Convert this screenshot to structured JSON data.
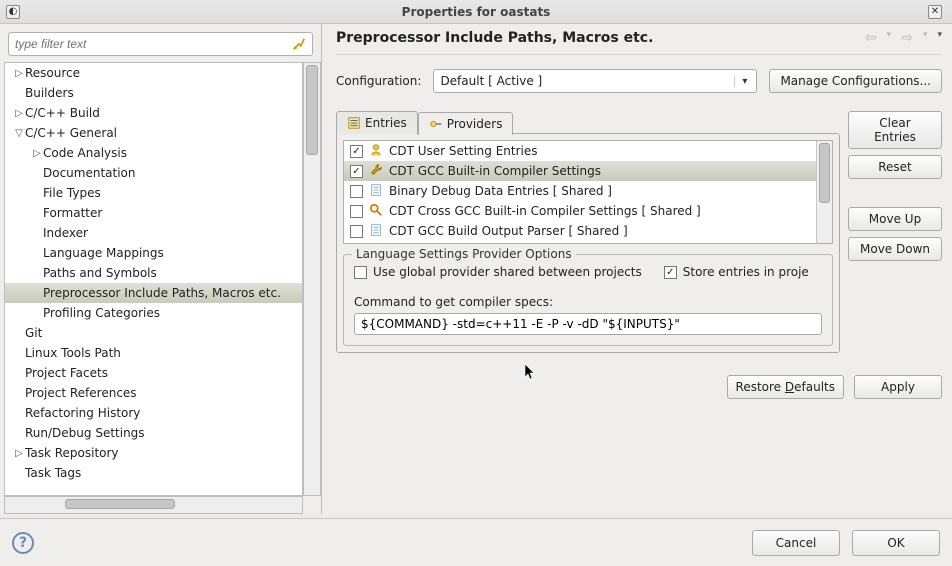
{
  "window": {
    "title": "Properties for oastats"
  },
  "filter": {
    "placeholder": "type filter text"
  },
  "tree": [
    {
      "label": "Resource",
      "indent": 0,
      "exp": "▷"
    },
    {
      "label": "Builders",
      "indent": 0,
      "exp": ""
    },
    {
      "label": "C/C++ Build",
      "indent": 0,
      "exp": "▷"
    },
    {
      "label": "C/C++ General",
      "indent": 0,
      "exp": "▽"
    },
    {
      "label": "Code Analysis",
      "indent": 1,
      "exp": "▷"
    },
    {
      "label": "Documentation",
      "indent": 1,
      "exp": ""
    },
    {
      "label": "File Types",
      "indent": 1,
      "exp": ""
    },
    {
      "label": "Formatter",
      "indent": 1,
      "exp": ""
    },
    {
      "label": "Indexer",
      "indent": 1,
      "exp": ""
    },
    {
      "label": "Language Mappings",
      "indent": 1,
      "exp": ""
    },
    {
      "label": "Paths and Symbols",
      "indent": 1,
      "exp": ""
    },
    {
      "label": "Preprocessor Include Paths, Macros etc.",
      "indent": 1,
      "exp": "",
      "sel": true
    },
    {
      "label": "Profiling Categories",
      "indent": 1,
      "exp": ""
    },
    {
      "label": "Git",
      "indent": 0,
      "exp": ""
    },
    {
      "label": "Linux Tools Path",
      "indent": 0,
      "exp": ""
    },
    {
      "label": "Project Facets",
      "indent": 0,
      "exp": ""
    },
    {
      "label": "Project References",
      "indent": 0,
      "exp": ""
    },
    {
      "label": "Refactoring History",
      "indent": 0,
      "exp": ""
    },
    {
      "label": "Run/Debug Settings",
      "indent": 0,
      "exp": ""
    },
    {
      "label": "Task Repository",
      "indent": 0,
      "exp": "▷"
    },
    {
      "label": "Task Tags",
      "indent": 0,
      "exp": ""
    }
  ],
  "page": {
    "heading": "Preprocessor Include Paths, Macros etc.",
    "config_label": "Configuration:",
    "config_value": "Default  [ Active ]",
    "manage": "Manage Configurations..."
  },
  "tabs": {
    "entries": "Entries",
    "providers": "Providers"
  },
  "providers": [
    {
      "checked": true,
      "icon": "person",
      "label": "CDT User Setting Entries"
    },
    {
      "checked": true,
      "icon": "wrench",
      "label": "CDT GCC Built-in Compiler Settings",
      "sel": true
    },
    {
      "checked": false,
      "icon": "doc",
      "label": "Binary Debug Data Entries   [ Shared ]"
    },
    {
      "checked": false,
      "icon": "lens",
      "label": "CDT Cross GCC Built-in Compiler Settings   [ Shared ]"
    },
    {
      "checked": false,
      "icon": "doc",
      "label": "CDT GCC Build Output Parser   [ Shared ]"
    }
  ],
  "sidebtns": {
    "clear": "Clear Entries",
    "reset": "Reset",
    "moveup": "Move Up",
    "movedown": "Move Down"
  },
  "group": {
    "title": "Language Settings Provider Options",
    "opt_global": "Use global provider shared between projects",
    "opt_store": "Store entries in proje",
    "cmd_label": "Command to get compiler specs:",
    "cmd_value": "${COMMAND} -std=c++11 -E -P -v -dD \"${INPUTS}\""
  },
  "actions": {
    "restore_pre": "Restore ",
    "restore_u": "D",
    "restore_post": "efaults",
    "apply": "Apply",
    "cancel": "Cancel",
    "ok": "OK"
  }
}
